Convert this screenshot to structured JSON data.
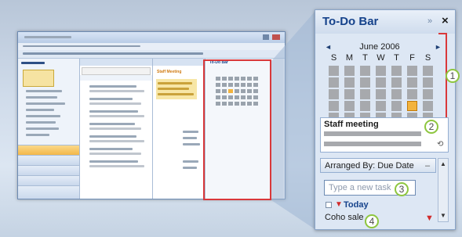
{
  "todo_bar": {
    "title": "To-Do Bar",
    "pin_icon": "double-chevron-icon",
    "close_label": "×",
    "prev_arrow": "◄",
    "next_arrow": "►",
    "month_label": "June 2006",
    "weekdays": [
      "S",
      "M",
      "T",
      "W",
      "T",
      "F",
      "S"
    ],
    "appointment_title": "Staff meeting",
    "arrange_label": "Arranged By: Due Date",
    "new_task_placeholder": "Type a new task",
    "group_today": "Today",
    "task_item": "Coho sale",
    "callouts": [
      "1",
      "2",
      "3",
      "4"
    ]
  },
  "mini_window": {
    "todo_title": "To-Do Bar",
    "pane_title": "Staff Meeting"
  },
  "colors": {
    "highlight": "#d9383a",
    "callout_ring": "#8ec63f",
    "selected_day": "#f3b33d",
    "title_blue": "#15428b"
  }
}
